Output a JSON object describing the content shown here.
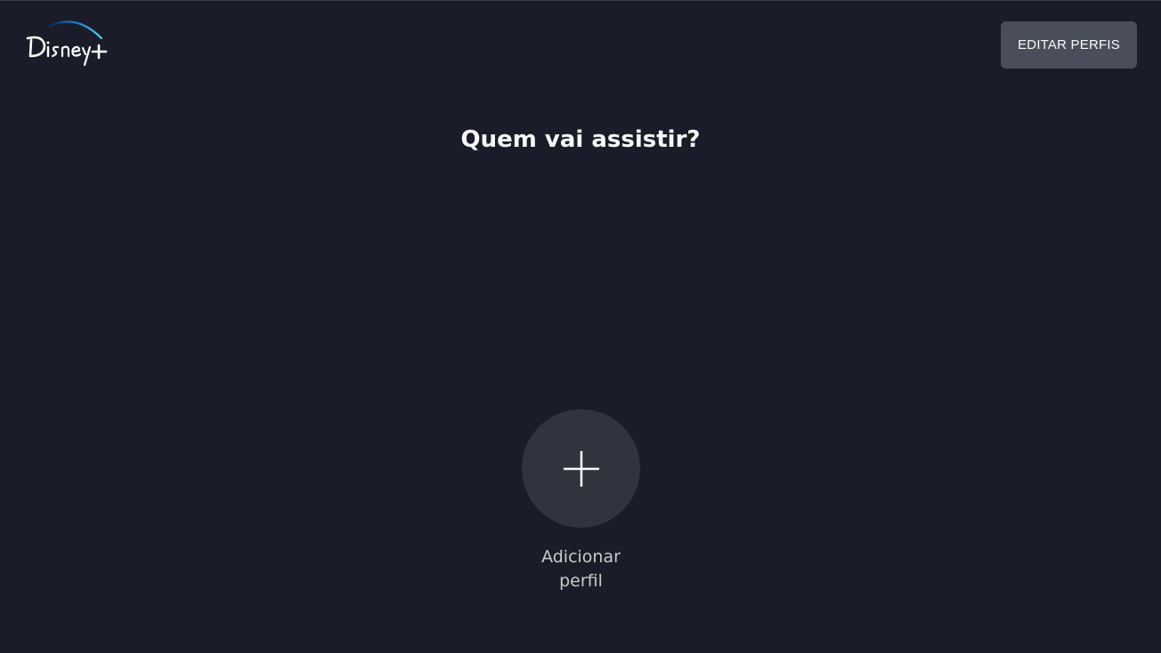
{
  "header": {
    "logo": {
      "icon": "disney-plus-logo-icon",
      "text": "Disney+",
      "arc_color": "#1b8fd8"
    },
    "edit_profiles_label": "EDITAR PERFIS"
  },
  "main": {
    "title": "Quem vai assistir?",
    "add_profile": {
      "icon": "plus-icon",
      "label": "Adicionar perfil"
    }
  },
  "colors": {
    "background": "#1a1d29",
    "button": "#4a4d5a",
    "circle": "#31343e",
    "text": "#f9f9f9",
    "muted_text": "#cacaca"
  }
}
